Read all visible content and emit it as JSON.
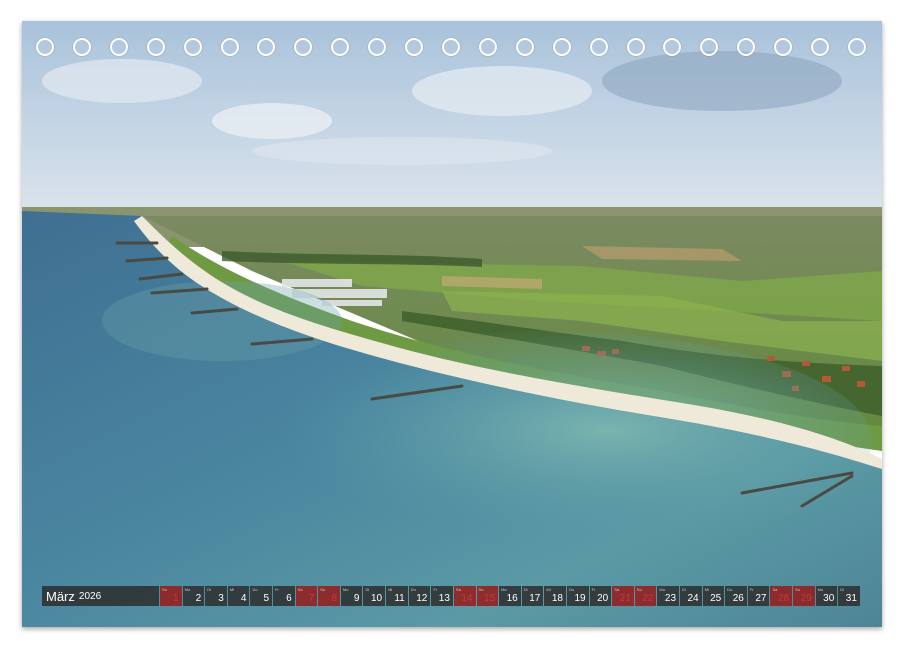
{
  "calendar": {
    "month": "März",
    "year": "2026",
    "days": [
      {
        "wd": "So",
        "num": "1",
        "weekend": true
      },
      {
        "wd": "Mo",
        "num": "2",
        "weekend": false
      },
      {
        "wd": "Di",
        "num": "3",
        "weekend": false
      },
      {
        "wd": "Mi",
        "num": "4",
        "weekend": false
      },
      {
        "wd": "Do",
        "num": "5",
        "weekend": false
      },
      {
        "wd": "Fr",
        "num": "6",
        "weekend": false
      },
      {
        "wd": "Sa",
        "num": "7",
        "weekend": true
      },
      {
        "wd": "So",
        "num": "8",
        "weekend": true
      },
      {
        "wd": "Mo",
        "num": "9",
        "weekend": false
      },
      {
        "wd": "Di",
        "num": "10",
        "weekend": false
      },
      {
        "wd": "Mi",
        "num": "11",
        "weekend": false
      },
      {
        "wd": "Do",
        "num": "12",
        "weekend": false
      },
      {
        "wd": "Fr",
        "num": "13",
        "weekend": false
      },
      {
        "wd": "Sa",
        "num": "14",
        "weekend": true
      },
      {
        "wd": "So",
        "num": "15",
        "weekend": true
      },
      {
        "wd": "Mo",
        "num": "16",
        "weekend": false
      },
      {
        "wd": "Di",
        "num": "17",
        "weekend": false
      },
      {
        "wd": "Mi",
        "num": "18",
        "weekend": false
      },
      {
        "wd": "Do",
        "num": "19",
        "weekend": false
      },
      {
        "wd": "Fr",
        "num": "20",
        "weekend": false
      },
      {
        "wd": "Sa",
        "num": "21",
        "weekend": true
      },
      {
        "wd": "So",
        "num": "22",
        "weekend": true
      },
      {
        "wd": "Mo",
        "num": "23",
        "weekend": false
      },
      {
        "wd": "Di",
        "num": "24",
        "weekend": false
      },
      {
        "wd": "Mi",
        "num": "25",
        "weekend": false
      },
      {
        "wd": "Do",
        "num": "26",
        "weekend": false
      },
      {
        "wd": "Fr",
        "num": "27",
        "weekend": false
      },
      {
        "wd": "Sa",
        "num": "28",
        "weekend": true
      },
      {
        "wd": "So",
        "num": "29",
        "weekend": true
      },
      {
        "wd": "Mo",
        "num": "30",
        "weekend": false
      },
      {
        "wd": "Di",
        "num": "31",
        "weekend": false
      }
    ]
  },
  "binding_holes": 23,
  "colors": {
    "bar": "#2d2d2d",
    "weekend": "#961a1a",
    "weekend_text": "#c23a3a"
  }
}
